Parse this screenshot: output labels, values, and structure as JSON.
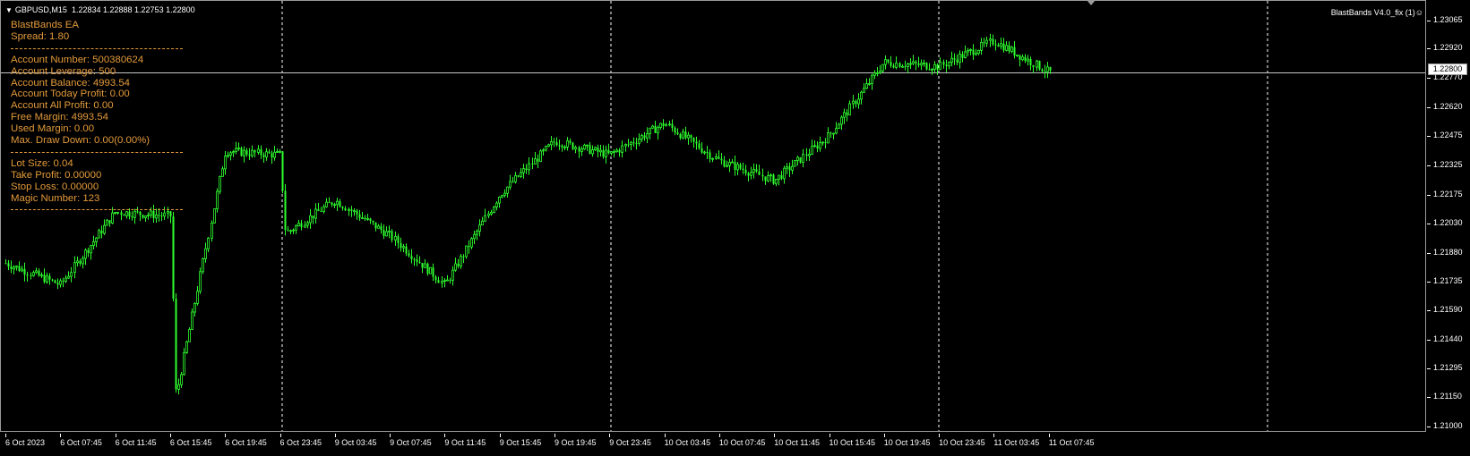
{
  "header": {
    "symbol": "GBPUSD,M15",
    "ohlc": "1.22834 1.22888 1.22753 1.22800"
  },
  "indicator_label": "BlastBands V4.0_fix (1)☺",
  "ea_panel": {
    "title": "BlastBands EA",
    "spread": "Spread: 1.80",
    "account_lines": [
      "Account Number: 500380624",
      "Account Leverage: 500",
      "Account Balance: 4993.54",
      "Account Today Profit: 0.00",
      "Account All Profit: 0.00",
      "Free Margin: 4993.54",
      "Used Margin: 0.00",
      "Max. Draw Down: 0.00(0.00%)"
    ],
    "trade_lines": [
      "Lot Size: 0.04",
      "Take Profit: 0.00000",
      "Stop Loss: 0.00000",
      "Magic Number: 123"
    ]
  },
  "price_axis": {
    "ticks": [
      "1.23065",
      "1.22920",
      "1.22770",
      "1.22620",
      "1.22475",
      "1.22325",
      "1.22175",
      "1.22030",
      "1.21880",
      "1.21735",
      "1.21590",
      "1.21440",
      "1.21295",
      "1.21150",
      "1.21000"
    ],
    "current_price": "1.22800"
  },
  "time_axis": {
    "labels": [
      "6 Oct 2023",
      "6 Oct 07:45",
      "6 Oct 11:45",
      "6 Oct 15:45",
      "6 Oct 19:45",
      "6 Oct 23:45",
      "9 Oct 03:45",
      "9 Oct 07:45",
      "9 Oct 11:45",
      "9 Oct 15:45",
      "9 Oct 19:45",
      "9 Oct 23:45",
      "10 Oct 03:45",
      "10 Oct 07:45",
      "10 Oct 11:45",
      "10 Oct 15:45",
      "10 Oct 19:45",
      "10 Oct 23:45",
      "11 Oct 03:45",
      "11 Oct 07:45"
    ]
  },
  "colors": {
    "candle": "#2dff2d",
    "background": "#000000",
    "text": "#ffffff",
    "panel_text": "#e39a3b",
    "separator": "#ffffff"
  },
  "chart_data": {
    "type": "candlestick",
    "symbol": "GBPUSD",
    "timeframe": "M15",
    "ylim": [
      1.21,
      1.2314
    ],
    "close_path": [
      [
        "6 Oct 2023",
        1.2183
      ],
      [
        "6 Oct 07:45",
        1.2172
      ],
      [
        "6 Oct 11:45",
        1.2209
      ],
      [
        "6 Oct 15:45",
        1.2207
      ],
      [
        "6 Oct 15:45",
        1.2115
      ],
      [
        "6 Oct 19:45",
        1.224
      ],
      [
        "6 Oct 23:45",
        1.2238
      ],
      [
        "6 Oct 23:45",
        1.2198
      ],
      [
        "9 Oct 03:45",
        1.2215
      ],
      [
        "9 Oct 07:45",
        1.2197
      ],
      [
        "9 Oct 11:45",
        1.2172
      ],
      [
        "9 Oct 15:45",
        1.2218
      ],
      [
        "9 Oct 19:45",
        1.2245
      ],
      [
        "9 Oct 23:45",
        1.2238
      ],
      [
        "10 Oct 03:45",
        1.2254
      ],
      [
        "10 Oct 07:45",
        1.2235
      ],
      [
        "10 Oct 11:45",
        1.2225
      ],
      [
        "10 Oct 15:45",
        1.2248
      ],
      [
        "10 Oct 19:45",
        1.2285
      ],
      [
        "10 Oct 23:45",
        1.2283
      ],
      [
        "11 Oct 03:45",
        1.2296
      ],
      [
        "11 Oct 07:45",
        1.228
      ]
    ]
  }
}
